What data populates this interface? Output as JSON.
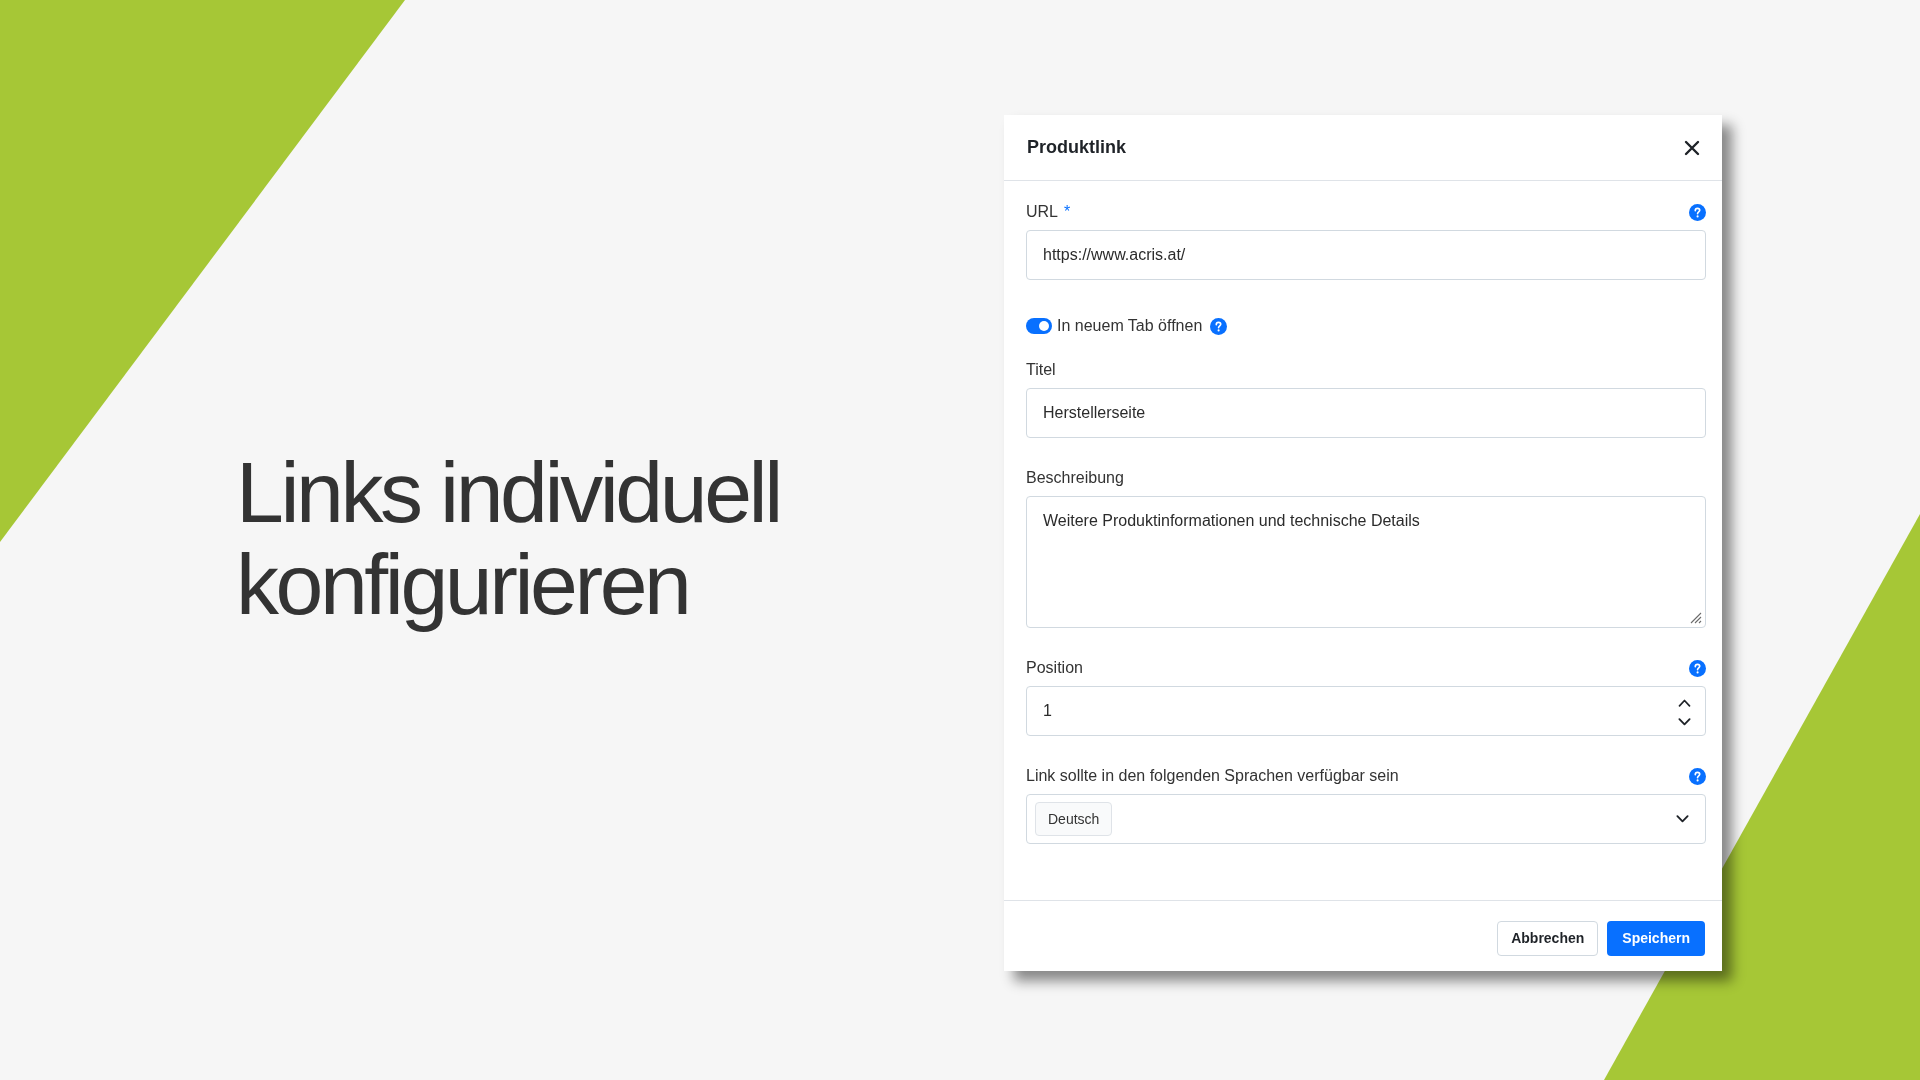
{
  "headline": "Links individuell konfigurieren",
  "dialog": {
    "title": "Produktlink",
    "fields": [
      {
        "kind": "text",
        "label": "URL",
        "required_mark": "*",
        "help": true,
        "value": "https://www.acris.at/"
      },
      {
        "kind": "switch",
        "label": "In neuem Tab öffnen",
        "on": true,
        "help": true
      },
      {
        "kind": "text",
        "label": "Titel",
        "help": false,
        "value": "Herstellerseite"
      },
      {
        "kind": "textarea",
        "label": "Beschreibung",
        "help": false,
        "value": "Weitere Produktinformationen und technische Details"
      },
      {
        "kind": "number",
        "label": "Position",
        "help": true,
        "value": "1"
      },
      {
        "kind": "multiselect",
        "label": "Link sollte in den folgenden Sprachen verfügbar sein",
        "help": true,
        "tags": [
          "Deutsch"
        ]
      }
    ],
    "buttons": [
      {
        "label": "Abbrechen",
        "kind": "secondary"
      },
      {
        "label": "Speichern",
        "kind": "primary"
      }
    ]
  }
}
